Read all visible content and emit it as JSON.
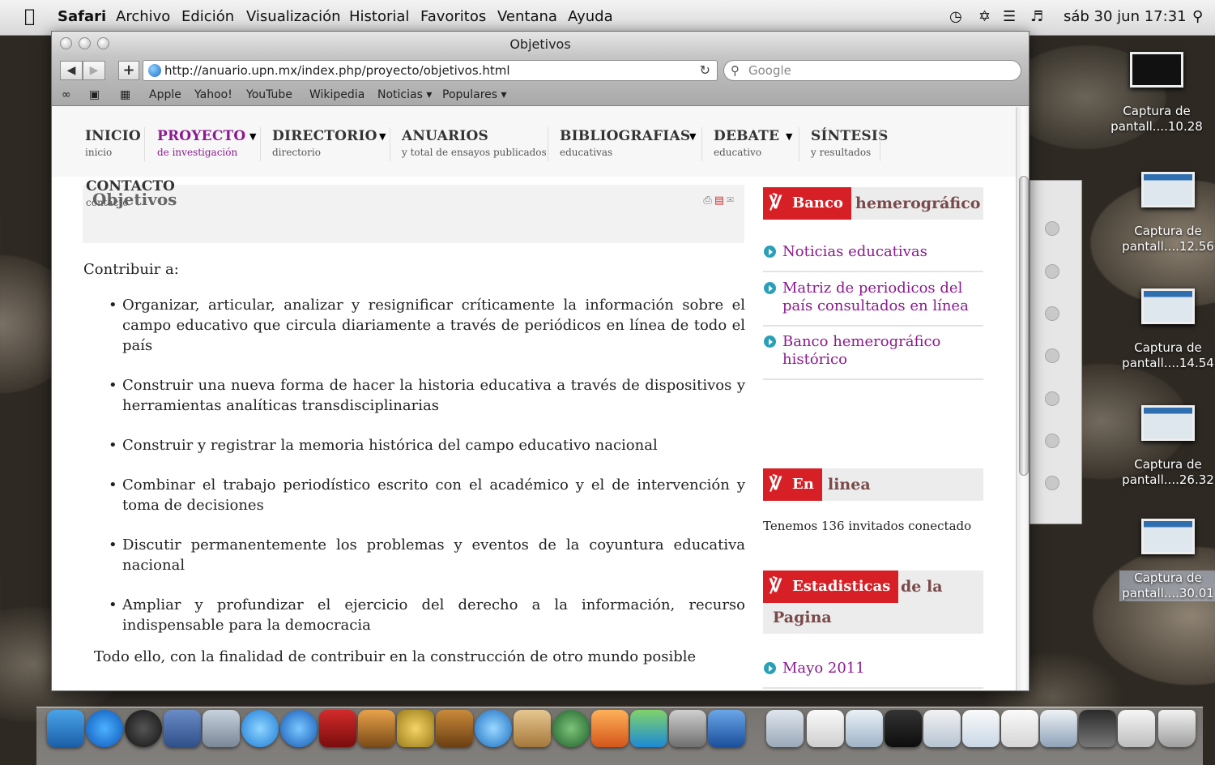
{
  "menubar": {
    "apple": "",
    "app": "Safari",
    "menus": [
      "Archivo",
      "Edición",
      "Visualización",
      "Historial",
      "Favoritos",
      "Ventana",
      "Ayuda"
    ],
    "clock": "sáb 30 jun 17:31",
    "status_icons": [
      "time-machine-icon",
      "bluetooth-icon",
      "wifi-icon",
      "volume-icon",
      "spotlight-icon"
    ]
  },
  "window": {
    "title": "Objetivos",
    "url": "http://anuario.upn.mx/index.php/proyecto/objetivos.html",
    "search_placeholder": "Google",
    "bookmarks": [
      "Apple",
      "Yahoo!",
      "YouTube",
      "Wikipedia",
      "Noticias ▾",
      "Populares ▾"
    ]
  },
  "page": {
    "nav": [
      {
        "title": "INICIO",
        "sub": "inicio"
      },
      {
        "title": "PROYECTO",
        "sub": "de investigación"
      },
      {
        "title": "DIRECTORIO",
        "sub": "directorio"
      },
      {
        "title": "ANUARIOS",
        "sub": "y total de ensayos publicados"
      },
      {
        "title": "BIBLIOGRAFIAS",
        "sub": "educativas"
      },
      {
        "title": "DEBATE",
        "sub": "educativo"
      },
      {
        "title": "SÍNTESIS",
        "sub": "y resultados"
      }
    ],
    "contact": {
      "title": "CONTACTO",
      "sub": "contacto"
    },
    "article_title": "Objetivos",
    "intro": "Contribuir a:",
    "objectives": [
      "Organizar, articular, analizar y resignificar críticamente la información sobre el campo educativo que circula diariamente a través de periódicos en línea de todo el país",
      "Construir una nueva forma de hacer la historia educativa a través de dispositivos y herramientas analíticas transdisciplinarias",
      "Construir y registrar la memoria histórica del campo educativo nacional",
      "Combinar el trabajo periodístico escrito con el académico y el de intervención y toma de decisiones",
      "Discutir permanentemente los problemas y eventos de la coyuntura educativa nacional",
      "Ampliar y profundizar el ejercicio del derecho a la información, recurso indispensable para la democracia"
    ],
    "closing": "Todo ello, con la finalidad de contribuir en la construcción de otro mundo posible"
  },
  "sidebar": {
    "banco": {
      "red": "Banco",
      "rest": "hemerográfico"
    },
    "banco_links": [
      "Noticias educativas",
      "Matriz de periodicos del país consultados en línea",
      "Banco hemerográfico histórico"
    ],
    "enlinea": {
      "red": "En",
      "rest": "linea"
    },
    "online_text": "Tenemos 136 invitados conectado",
    "stats": {
      "red": "Estadisticas",
      "rest": "de la",
      "rest2": "Pagina"
    },
    "stats_links": [
      "Mayo 2011"
    ]
  },
  "desktop_icons": [
    {
      "label": "Captura de pantall....10.28"
    },
    {
      "label": "Captura de pantall....12.56"
    },
    {
      "label": "Captura de pantall....14.54"
    },
    {
      "label": "Captura de pantall....26.32"
    },
    {
      "label": "Captura de pantall....30.01"
    }
  ],
  "colors": {
    "accent": "#8b1a8f",
    "module_red": "#d71f26",
    "bullet_teal": "#2aa0b8"
  }
}
